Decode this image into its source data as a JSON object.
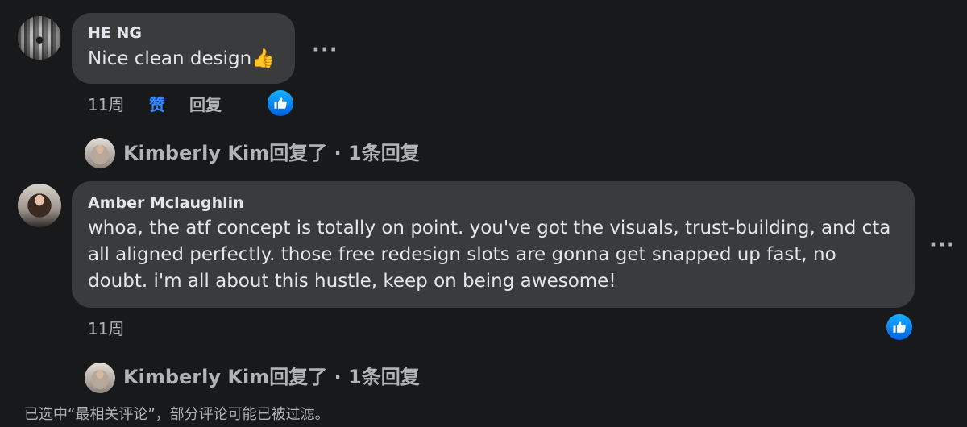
{
  "comments": [
    {
      "author": "HE NG",
      "text": "Nice clean design",
      "emoji": "👍",
      "time": "11周",
      "like_label": "赞",
      "reply_label": "回复",
      "more_menu": "···"
    },
    {
      "author": "Amber Mclaughlin",
      "text": "whoa, the atf concept is totally on point. you've got the visuals, trust-building, and cta all aligned perfectly. those free redesign slots are gonna get snapped up fast, no doubt. i'm all about this hustle, keep on being awesome!",
      "time": "11周",
      "more_menu": "···"
    }
  ],
  "reply_threads": [
    {
      "name": "Kimberly Kim",
      "action": "回复了",
      "separator": " · ",
      "count": "1条回复"
    },
    {
      "name": "Kimberly Kim",
      "action": "回复了",
      "separator": " · ",
      "count": "1条回复"
    }
  ],
  "footer_note": "已选中“最相关评论”，部分评论可能已被过滤。",
  "colors": {
    "background": "#18191a",
    "bubble": "#3a3b3c",
    "accent": "#2e89ff",
    "secondary_text": "#b0b3b8"
  },
  "icons": [
    "like-badge-icon",
    "more-options-icon",
    "thumbs-up-emoji"
  ]
}
